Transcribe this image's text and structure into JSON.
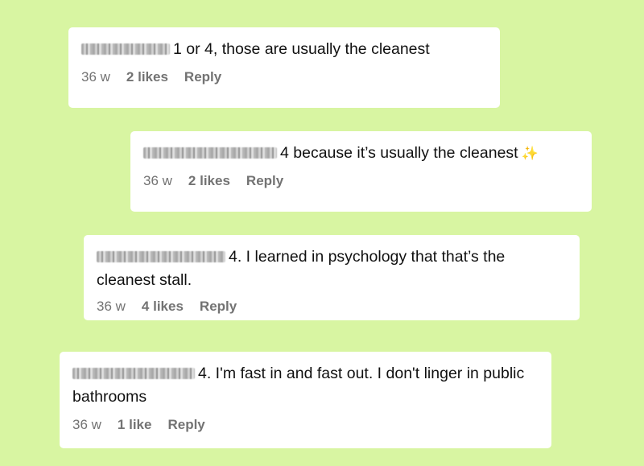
{
  "comments": [
    {
      "text": "1 or 4, those are usually the cleanest",
      "time": "36 w",
      "likes": "2 likes",
      "reply": "Reply"
    },
    {
      "text": "4 because it’s usually the cleanest",
      "emoji": "✨",
      "time": "36 w",
      "likes": "2 likes",
      "reply": "Reply"
    },
    {
      "text": "4. I learned in psychology that that’s the cleanest stall.",
      "time": "36 w",
      "likes": "4 likes",
      "reply": "Reply"
    },
    {
      "text": "4. I'm fast in and fast out. I don't linger in public bathrooms",
      "time": "36 w",
      "likes": "1 like",
      "reply": "Reply"
    }
  ],
  "colors": {
    "background": "#d8f5a2",
    "card": "#ffffff",
    "meta_text": "#737373"
  }
}
